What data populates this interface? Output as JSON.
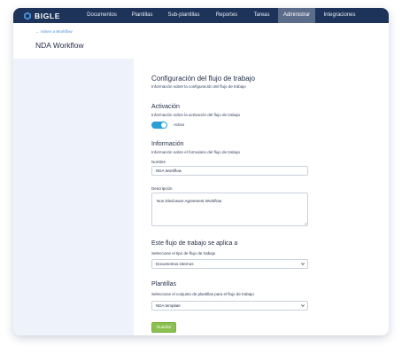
{
  "app": {
    "logo_text": "BIGLE",
    "logo_icon": "hexagon-logo-icon"
  },
  "nav": {
    "items": [
      {
        "label": "Documentos",
        "active": false
      },
      {
        "label": "Plantillas",
        "active": false
      },
      {
        "label": "Sub-plantillas",
        "active": false
      },
      {
        "label": "Reportes",
        "active": false
      },
      {
        "label": "Tareas",
        "active": false
      },
      {
        "label": "Administrar",
        "active": true
      },
      {
        "label": "Integraciones",
        "active": false
      }
    ]
  },
  "header": {
    "back_link": "← Volver a Workflow",
    "title": "NDA Workflow"
  },
  "form": {
    "section_title": "Configuración del flujo de trabajo",
    "section_desc": "Información sobre la configuración del flujo de trabajo",
    "activation": {
      "title": "Activación",
      "desc": "Información sobre la activación del flujo de trabajo",
      "toggle_label": "Activo",
      "enabled": true
    },
    "information": {
      "title": "Información",
      "desc": "Información sobre el formulario del flujo de trabajo",
      "name_label": "Nombre",
      "name_value": "NDA Workflow",
      "description_label": "Descripción",
      "description_value": "Non Disclosure Agreement Workflow"
    },
    "applies_to": {
      "title": "Este flujo de trabajo se aplica a",
      "label": "Seleccione el tipo de flujo de trabajo",
      "selected": "Documentos internos"
    },
    "templates": {
      "title": "Plantillas",
      "label": "Seleccione el conjunto de plantillas para el flujo de trabajo",
      "selected": "NDA template"
    },
    "save_label": "Guardar"
  },
  "colors": {
    "navbar": "#1e3359",
    "nav_active": "#5b6c8a",
    "toggle_on": "#2a9fd6",
    "save_button": "#8cc152",
    "link": "#4a8fd8",
    "left_pane": "#eef3fb"
  }
}
